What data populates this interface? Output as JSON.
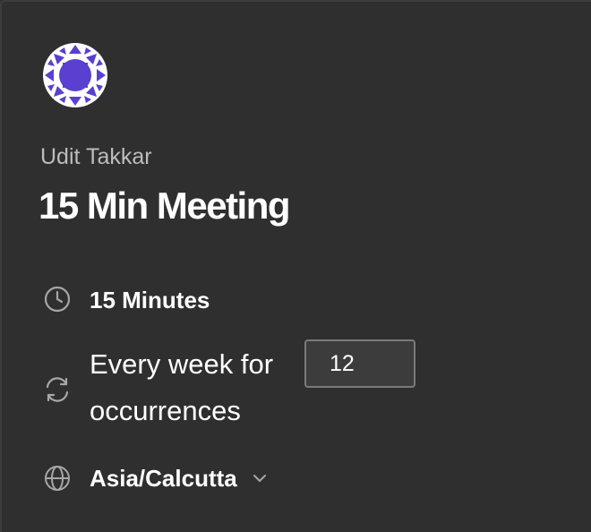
{
  "event": {
    "host_name": "Udit Takkar",
    "title": "15 Min Meeting"
  },
  "details": {
    "duration_icon": "clock-icon",
    "duration": "15 Minutes",
    "recurrence_icon": "refresh-icon",
    "recurrence_prefix": "Every week for",
    "recurrence_count": "12",
    "recurrence_suffix": "occurrences",
    "timezone_icon": "globe-icon",
    "timezone": "Asia/Calcutta",
    "timezone_chevron_icon": "chevron-down-icon"
  },
  "colors": {
    "background": "#2f2f2f",
    "avatar_brand": "#5b3fd0",
    "text_primary": "#ffffff",
    "text_secondary": "#bdbdbd",
    "icon": "#a6a6a6"
  }
}
